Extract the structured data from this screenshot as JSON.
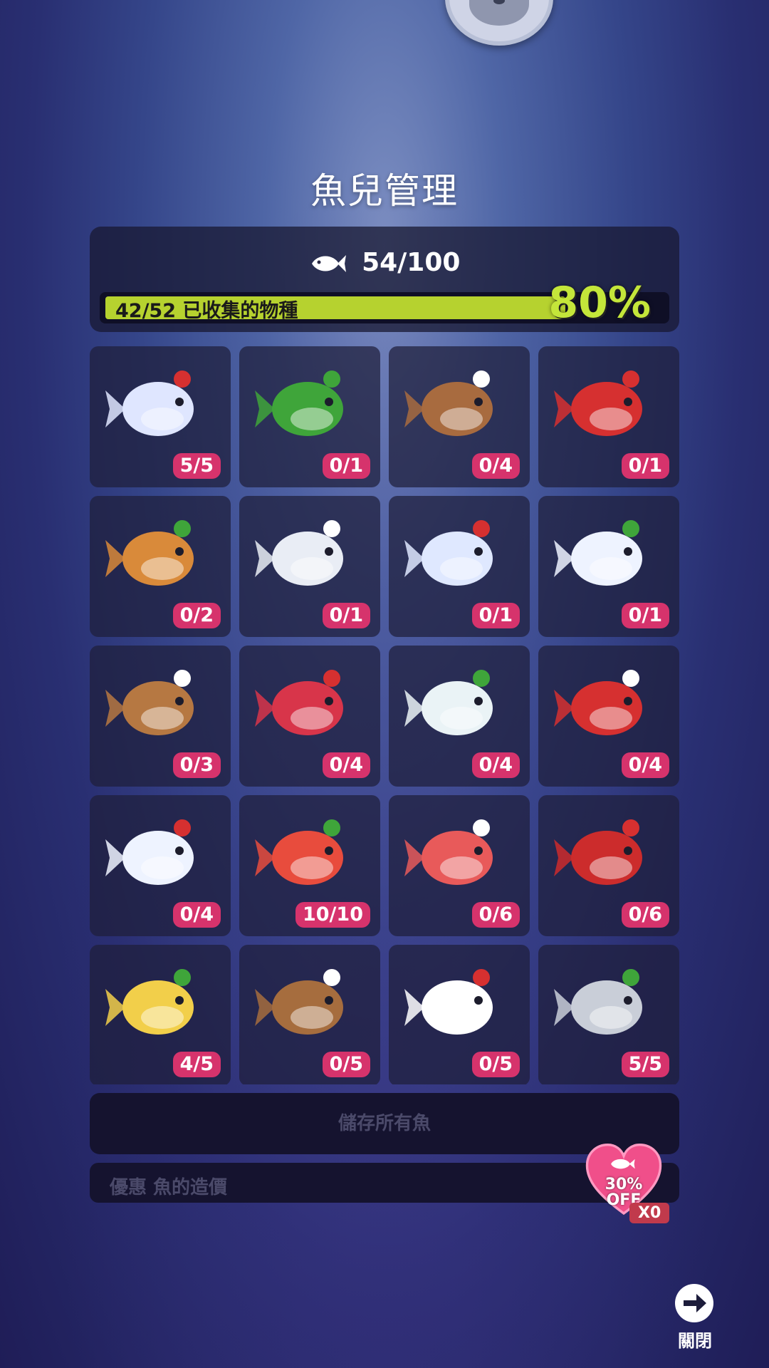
{
  "page": {
    "title": "魚兒管理"
  },
  "summary": {
    "fish_count": "54/100",
    "collection_text": "42/52 已收集的物種",
    "collection_percent_label": "80%",
    "collection_progress": 0.8,
    "fish_icon": "fish-icon"
  },
  "fish_items": [
    {
      "name": "ice-crystal-fish",
      "count": "5/5",
      "color": "#dfe6ff"
    },
    {
      "name": "holly-leaf-fish",
      "count": "0/1",
      "color": "#3fa53a"
    },
    {
      "name": "gingerbread-fish",
      "count": "0/4",
      "color": "#a86b3f"
    },
    {
      "name": "santa-hat-fish",
      "count": "0/1",
      "color": "#d63030"
    },
    {
      "name": "spotted-deer-fish",
      "count": "0/2",
      "color": "#d98a3a"
    },
    {
      "name": "snowman-angel-fish",
      "count": "0/1",
      "color": "#e9edf5"
    },
    {
      "name": "ice-shard-eel",
      "count": "0/1",
      "color": "#dfe8ff"
    },
    {
      "name": "snowball-candy-fish",
      "count": "0/1",
      "color": "#eef3ff"
    },
    {
      "name": "reindeer-puffer",
      "count": "0/3",
      "color": "#b67842"
    },
    {
      "name": "clown-fish-bell",
      "count": "0/4",
      "color": "#d8354a"
    },
    {
      "name": "snow-tree-whale",
      "count": "0/4",
      "color": "#eaf3f6"
    },
    {
      "name": "santa-angler-fish",
      "count": "0/4",
      "color": "#d63030"
    },
    {
      "name": "snowflake-narwhal",
      "count": "0/4",
      "color": "#eef3ff"
    },
    {
      "name": "candle-seahorse",
      "count": "10/10",
      "color": "#e84c3d"
    },
    {
      "name": "stocking-seahorse",
      "count": "0/6",
      "color": "#e85a5a"
    },
    {
      "name": "santa-puff-fish",
      "count": "0/6",
      "color": "#cc2c2c"
    },
    {
      "name": "bell-squid",
      "count": "4/5",
      "color": "#f2cf4a"
    },
    {
      "name": "reindeer-octopus",
      "count": "0/5",
      "color": "#a66d3e"
    },
    {
      "name": "holly-sea-dragon",
      "count": "0/5",
      "color": "#ffffff"
    },
    {
      "name": "crystal-jelly",
      "count": "5/5",
      "color": "#c9ced8"
    }
  ],
  "actions": {
    "store_all_label": "儲存所有魚",
    "discount_label": "優惠 魚的造價",
    "discount_badge_percent": "30%",
    "discount_badge_off": "OFF",
    "discount_badge_count": "X0",
    "close_label": "關閉"
  },
  "colors": {
    "accent_green": "#b6d22f",
    "badge_pink": "#d6336c",
    "heart_pink": "#f04f8a"
  }
}
